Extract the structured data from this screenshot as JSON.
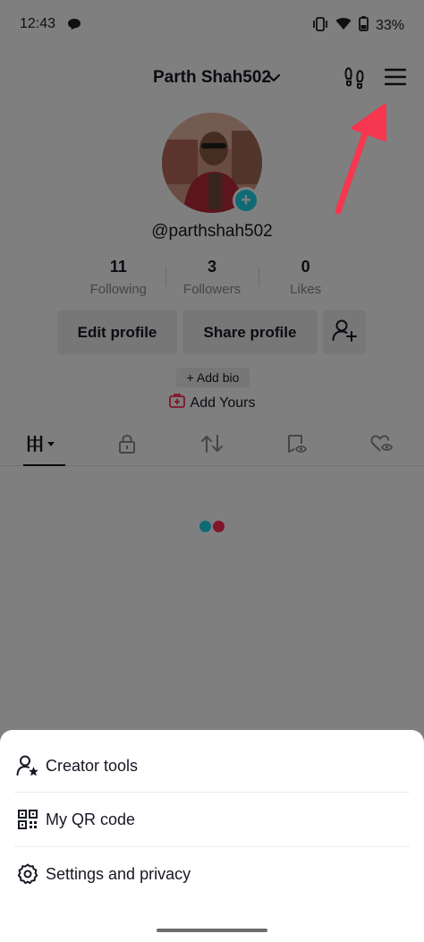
{
  "status_bar": {
    "time": "12:43",
    "battery": "33%"
  },
  "profile": {
    "name": "Parth Shah502",
    "handle": "@parthshah502",
    "stats": [
      {
        "value": "11",
        "label": "Following"
      },
      {
        "value": "3",
        "label": "Followers"
      },
      {
        "value": "0",
        "label": "Likes"
      }
    ],
    "edit_profile_label": "Edit profile",
    "share_profile_label": "Share profile",
    "add_bio_label": "+ Add bio",
    "add_yours_label": "Add Yours"
  },
  "tabs": [
    {
      "icon": "grid-icon",
      "active": true
    },
    {
      "icon": "lock-icon",
      "active": false
    },
    {
      "icon": "repost-icon",
      "active": false
    },
    {
      "icon": "saved-icon",
      "active": false
    },
    {
      "icon": "liked-icon",
      "active": false
    }
  ],
  "sheet": {
    "items": [
      {
        "label": "Creator tools",
        "icon": "creator-tools-icon"
      },
      {
        "label": "My QR code",
        "icon": "qr-code-icon"
      },
      {
        "label": "Settings and privacy",
        "icon": "settings-gear-icon"
      }
    ]
  },
  "colors": {
    "accent_teal": "#20d5ec",
    "accent_red": "#fe2c55",
    "arrow_red": "#f5374f",
    "overlay": "rgba(0,0,0,0.5)"
  }
}
